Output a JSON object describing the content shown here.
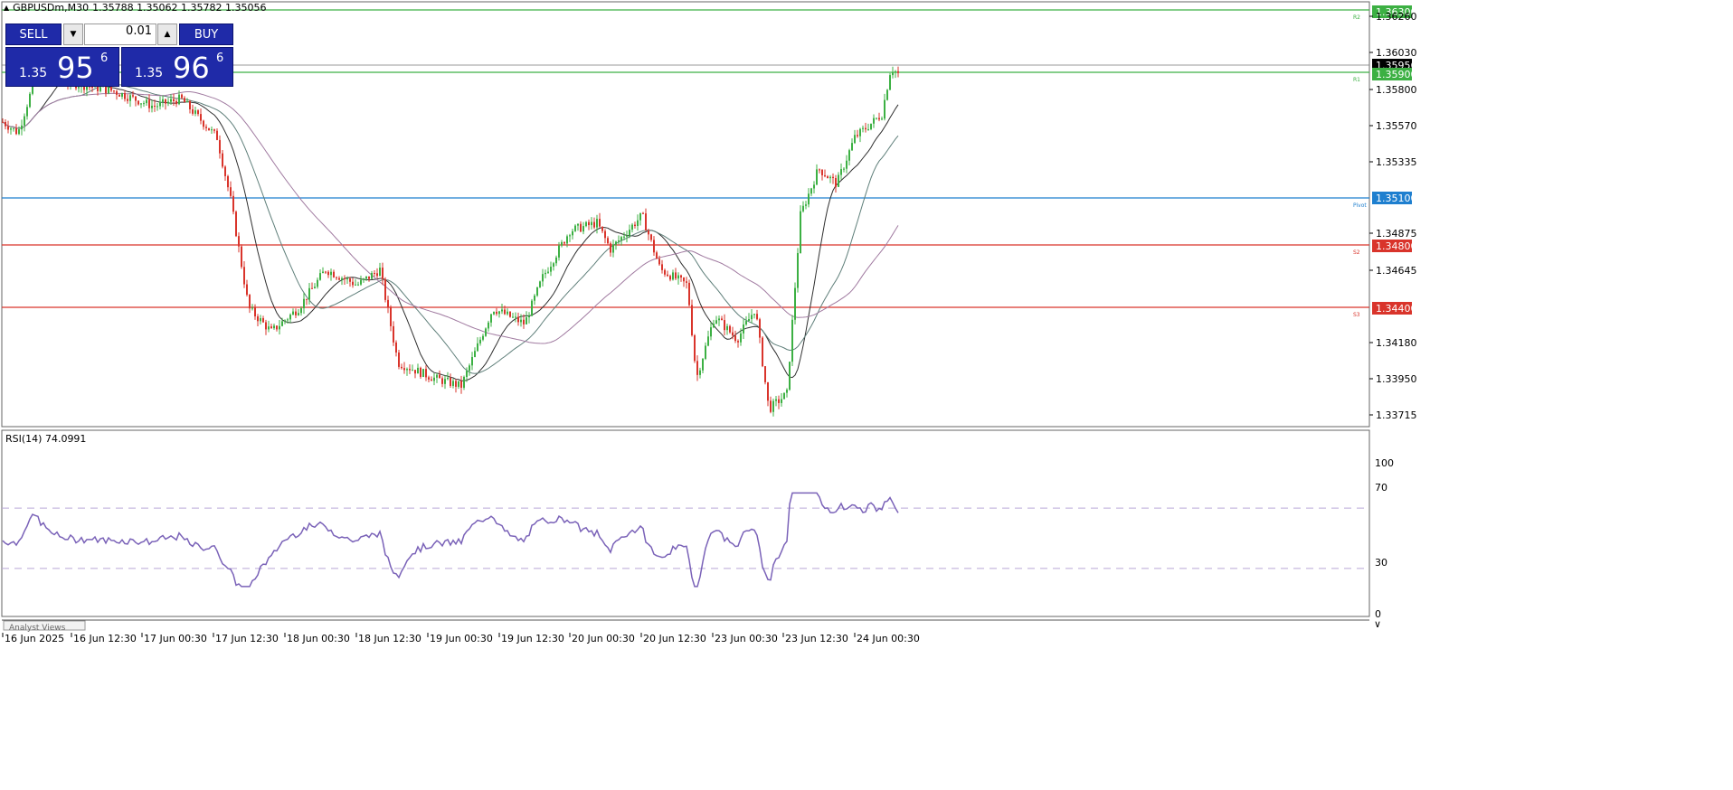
{
  "header": {
    "symbol": "GBPUSDm,M30",
    "ohlc": "1.35788 1.35062 1.35782 1.35056"
  },
  "trade_panel": {
    "sell_label": "SELL",
    "buy_label": "BUY",
    "lot": "0.01",
    "sell_prefix": "1.35",
    "sell_big": "95",
    "sell_sup": "6",
    "buy_prefix": "1.35",
    "buy_big": "96",
    "buy_sup": "6"
  },
  "price_axis": [
    "1.36300",
    "1.36260",
    "1.36030",
    "1.35956",
    "1.35900",
    "1.35800",
    "1.35570",
    "1.35335",
    "1.35100",
    "1.34875",
    "1.34800",
    "1.34645",
    "1.34400",
    "1.34180",
    "1.33950",
    "1.33715"
  ],
  "levels": [
    {
      "label": "R2",
      "price": "1.36300",
      "color": "#3cb043"
    },
    {
      "label": "R1",
      "price": "1.35900",
      "color": "#3cb043"
    },
    {
      "label": "Pivot",
      "price": "1.35100",
      "color": "#1e7fcf"
    },
    {
      "label": "S2",
      "price": "1.34800",
      "color": "#d9342b"
    },
    {
      "label": "S3",
      "price": "1.34400",
      "color": "#d9342b"
    }
  ],
  "current_price": "1.35956",
  "rsi": {
    "label": "RSI(14) 74.0991",
    "axis": [
      "100",
      "70",
      "30",
      "0"
    ]
  },
  "time_axis": [
    "16 Jun 2025",
    "16 Jun 12:30",
    "17 Jun 00:30",
    "17 Jun 12:30",
    "18 Jun 00:30",
    "18 Jun 12:30",
    "19 Jun 00:30",
    "19 Jun 12:30",
    "20 Jun 00:30",
    "20 Jun 12:30",
    "23 Jun 00:30",
    "23 Jun 12:30",
    "24 Jun 00:30"
  ],
  "bottom_tab": "Analyst Views",
  "colors": {
    "bull": "#3cb043",
    "bear": "#d9342b",
    "rsi_line": "#7a62b8",
    "ma_fast": "#2f2f2f",
    "ma_mid": "#5f7f7a",
    "ma_slow": "#a07aa0"
  }
}
